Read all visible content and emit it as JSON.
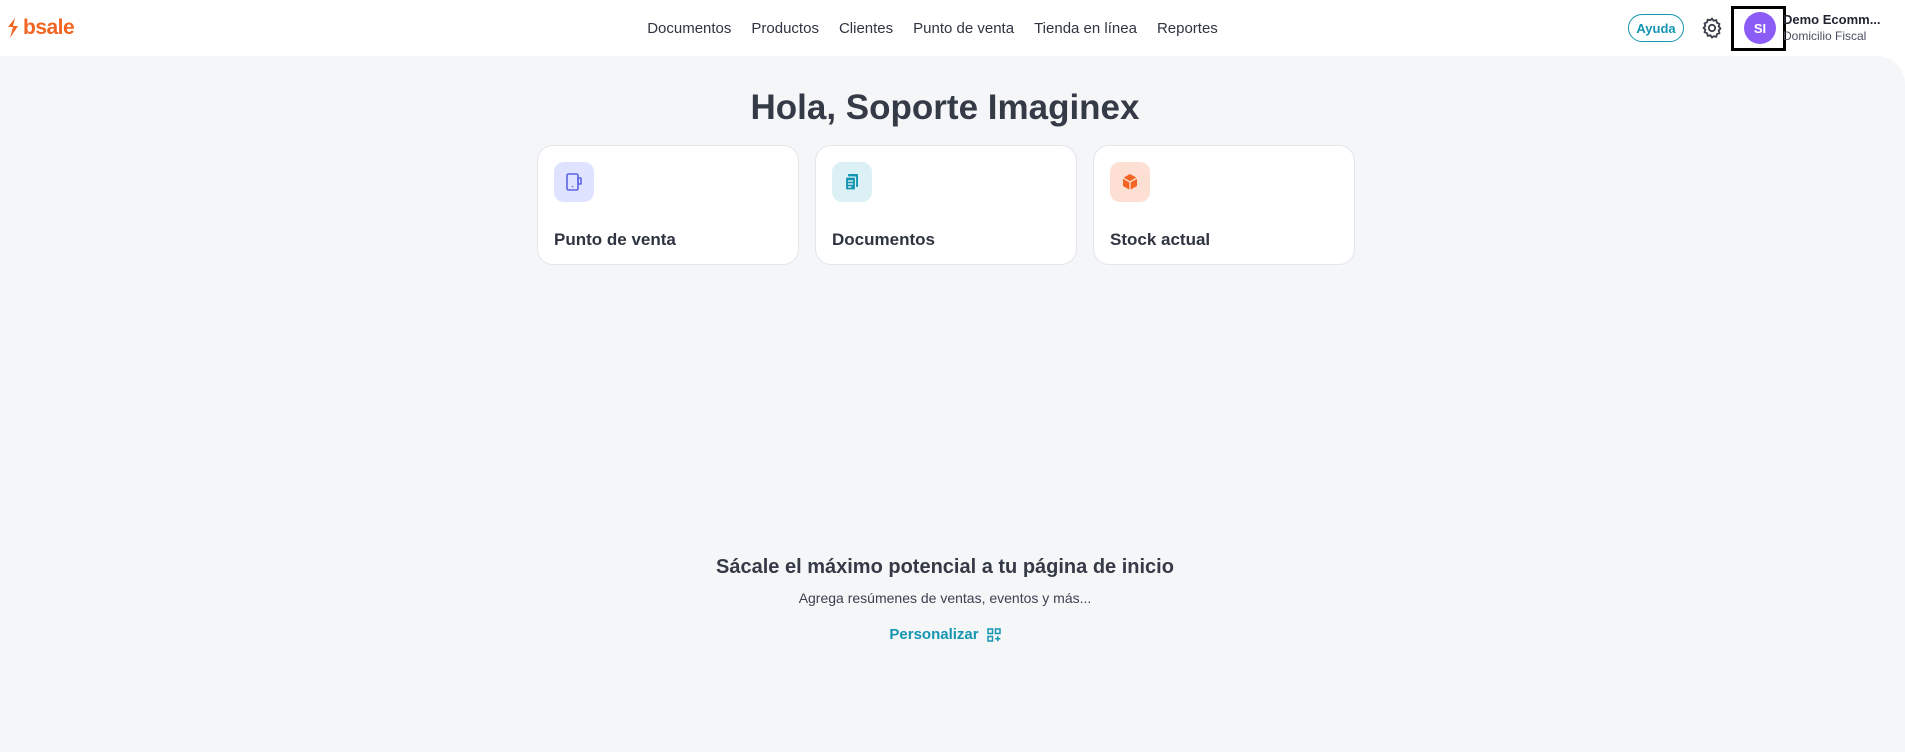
{
  "brand": {
    "name": "bsale",
    "color": "#f26522"
  },
  "nav": {
    "items": [
      {
        "label": "Documentos"
      },
      {
        "label": "Productos"
      },
      {
        "label": "Clientes"
      },
      {
        "label": "Punto de venta"
      },
      {
        "label": "Tienda en línea"
      },
      {
        "label": "Reportes"
      }
    ]
  },
  "header": {
    "help_label": "Ayuda",
    "settings_icon": "gear-icon",
    "avatar_initials": "SI",
    "account_name": "Demo Ecomm...",
    "account_sub": "Domicilio Fiscal"
  },
  "main": {
    "greeting": "Hola, Soporte Imaginex",
    "cards": [
      {
        "label": "Punto de venta",
        "icon": "pos-terminal-icon",
        "icon_bg": "#dfe3ff",
        "icon_color": "#5a64e6"
      },
      {
        "label": "Documentos",
        "icon": "document-icon",
        "icon_bg": "#dcf1f5",
        "icon_color": "#1495b2"
      },
      {
        "label": "Stock actual",
        "icon": "box-icon",
        "icon_bg": "#fde0d3",
        "icon_color": "#f26522"
      }
    ],
    "promo_title": "Sácale el máximo potencial a tu página de inicio",
    "promo_sub": "Agrega resúmenes de ventas, eventos y más...",
    "personalize_label": "Personalizar"
  },
  "colors": {
    "accent": "#1495b2",
    "avatar": "#8b5cf6",
    "background": "#f5f6f8"
  }
}
